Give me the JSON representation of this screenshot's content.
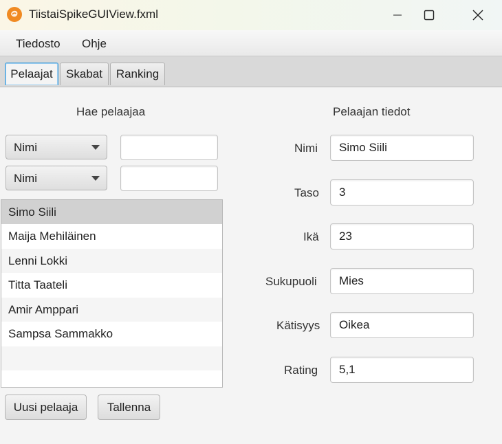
{
  "window": {
    "title": "TiistaiSpikeGUIView.fxml",
    "controls": [
      "minimize-icon",
      "maximize-icon",
      "close-icon"
    ]
  },
  "menu": {
    "items": [
      {
        "label": "Tiedosto"
      },
      {
        "label": "Ohje"
      }
    ]
  },
  "tabs": [
    {
      "label": "Pelaajat",
      "active": true
    },
    {
      "label": "Skabat",
      "active": false
    },
    {
      "label": "Ranking",
      "active": false
    }
  ],
  "search": {
    "heading": "Hae pelaajaa",
    "filters": [
      {
        "field": "Nimi",
        "value": ""
      },
      {
        "field": "Nimi",
        "value": ""
      }
    ]
  },
  "players": {
    "items": [
      {
        "name": "Simo Siili",
        "selected": true
      },
      {
        "name": "Maija Mehiläinen",
        "selected": false
      },
      {
        "name": "Lenni Lokki",
        "selected": false
      },
      {
        "name": "Titta Taateli",
        "selected": false
      },
      {
        "name": "Amir Amppari",
        "selected": false
      },
      {
        "name": "Sampsa Sammakko",
        "selected": false
      }
    ]
  },
  "buttons": {
    "new_player": "Uusi pelaaja",
    "save": "Tallenna"
  },
  "details": {
    "heading": "Pelaajan tiedot",
    "fields": [
      {
        "label": "Nimi",
        "value": "Simo Siili"
      },
      {
        "label": "Taso",
        "value": "3"
      },
      {
        "label": "Ikä",
        "value": "23"
      },
      {
        "label": "Sukupuoli",
        "value": "Mies"
      },
      {
        "label": "Kätisyys",
        "value": "Oikea"
      },
      {
        "label": "Rating",
        "value": "5,1"
      }
    ]
  },
  "colors": {
    "accent_focus": "#3a9ad9",
    "app_icon": "#f08a22",
    "selection": "#d1d1d1"
  }
}
